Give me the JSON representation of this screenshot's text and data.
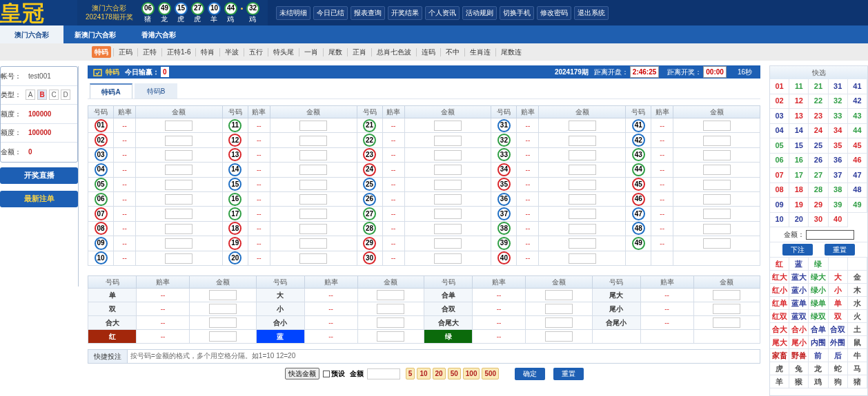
{
  "header": {
    "logo": "皇冠",
    "lottery_name": "澳门六合彩",
    "draw": "2024178期开奖",
    "balls": [
      {
        "number": "06",
        "zodiac": "猪",
        "color": "#2f9e44"
      },
      {
        "number": "49",
        "zodiac": "龙",
        "color": "#2f9e44"
      },
      {
        "number": "15",
        "zodiac": "虎",
        "color": "#1f6fc4"
      },
      {
        "number": "27",
        "zodiac": "虎",
        "color": "#2f9e44"
      },
      {
        "number": "10",
        "zodiac": "羊",
        "color": "#1f6fc4"
      },
      {
        "number": "44",
        "zodiac": "鸡",
        "color": "#2f9e44"
      }
    ],
    "special_ball": {
      "number": "32",
      "zodiac": "鸡",
      "color": "#2f9e44"
    }
  },
  "nav": [
    "未结明细",
    "今日已结",
    "报表查询",
    "开奖结果",
    "个人资讯",
    "活动规则",
    "切换手机",
    "修改密码",
    "退出系统"
  ],
  "tabs": [
    {
      "label": "澳门六合彩",
      "selected": true
    },
    {
      "label": "新澳门六合彩",
      "selected": false
    },
    {
      "label": "香港六合彩",
      "selected": false
    }
  ],
  "subnav": [
    {
      "label": "特码",
      "selected": true
    },
    {
      "label": "正码",
      "selected": false
    },
    {
      "label": "正特",
      "selected": false
    },
    {
      "label": "正特1-6",
      "selected": false
    },
    {
      "label": "特肖",
      "selected": false
    },
    {
      "label": "半波",
      "selected": false
    },
    {
      "label": "五行",
      "selected": false
    },
    {
      "label": "特头尾",
      "selected": false
    },
    {
      "label": "一肖",
      "selected": false
    },
    {
      "label": "尾数",
      "selected": false
    },
    {
      "label": "正肖",
      "selected": false
    },
    {
      "label": "总肖七色波",
      "selected": false
    },
    {
      "label": "连码",
      "selected": false
    },
    {
      "label": "不中",
      "selected": false
    },
    {
      "label": "生肖连",
      "selected": false
    },
    {
      "label": "尾数连",
      "selected": false
    }
  ],
  "account": {
    "rows": [
      {
        "kind": "text",
        "label": "帐号：",
        "value": "test001"
      },
      {
        "kind": "types",
        "label": "类型：",
        "options": [
          {
            "label": "A",
            "selected": false
          },
          {
            "label": "B",
            "selected": true
          },
          {
            "label": "C",
            "selected": false
          },
          {
            "label": "D",
            "selected": false
          }
        ]
      },
      {
        "kind": "money",
        "label": "额度：",
        "value": "100000"
      },
      {
        "kind": "money",
        "label": "额度：",
        "value": "100000"
      },
      {
        "kind": "money",
        "label": "金额：",
        "value": "0"
      }
    ],
    "buttons": [
      "开奖直播",
      "最新注单"
    ]
  },
  "panel": {
    "title": "特码",
    "today_label": "今日输赢：",
    "today_value": "0",
    "period": "2024179期",
    "open_label": "距离开盘：",
    "open_time": "2:46:25",
    "draw_label": "距离开奖：",
    "draw_time": "00:00",
    "countdown": "16秒"
  },
  "subtabs": [
    {
      "label": "特码A",
      "selected": true
    },
    {
      "label": "特码B",
      "selected": false
    }
  ],
  "table": {
    "groups": [
      {
        "columns": [
          "号码",
          "赔率",
          "金额"
        ],
        "items": [
          {
            "number": "01",
            "color": "#d9262b",
            "odds": "--"
          },
          {
            "number": "02",
            "color": "#d9262b",
            "odds": "--"
          },
          {
            "number": "03",
            "color": "#1f6fc4",
            "odds": "--"
          },
          {
            "number": "04",
            "color": "#1f6fc4",
            "odds": "--"
          },
          {
            "number": "05",
            "color": "#2f9e44",
            "odds": "--"
          },
          {
            "number": "06",
            "color": "#2f9e44",
            "odds": "--"
          },
          {
            "number": "07",
            "color": "#d9262b",
            "odds": "--"
          },
          {
            "number": "08",
            "color": "#d9262b",
            "odds": "--"
          },
          {
            "number": "09",
            "color": "#1f6fc4",
            "odds": "--"
          },
          {
            "number": "10",
            "color": "#1f6fc4",
            "odds": "--"
          }
        ]
      },
      {
        "columns": [
          "号码",
          "赔率",
          "金额"
        ],
        "items": [
          {
            "number": "11",
            "color": "#2f9e44",
            "odds": "--"
          },
          {
            "number": "12",
            "color": "#d9262b",
            "odds": "--"
          },
          {
            "number": "13",
            "color": "#d9262b",
            "odds": "--"
          },
          {
            "number": "14",
            "color": "#1f6fc4",
            "odds": "--"
          },
          {
            "number": "15",
            "color": "#1f6fc4",
            "odds": "--"
          },
          {
            "number": "16",
            "color": "#2f9e44",
            "odds": "--"
          },
          {
            "number": "17",
            "color": "#2f9e44",
            "odds": "--"
          },
          {
            "number": "18",
            "color": "#d9262b",
            "odds": "--"
          },
          {
            "number": "19",
            "color": "#d9262b",
            "odds": "--"
          },
          {
            "number": "20",
            "color": "#1f6fc4",
            "odds": "--"
          }
        ]
      },
      {
        "columns": [
          "号码",
          "赔率",
          "金额"
        ],
        "items": [
          {
            "number": "21",
            "color": "#2f9e44",
            "odds": "--"
          },
          {
            "number": "22",
            "color": "#2f9e44",
            "odds": "--"
          },
          {
            "number": "23",
            "color": "#d9262b",
            "odds": "--"
          },
          {
            "number": "24",
            "color": "#d9262b",
            "odds": "--"
          },
          {
            "number": "25",
            "color": "#1f6fc4",
            "odds": "--"
          },
          {
            "number": "26",
            "color": "#1f6fc4",
            "odds": "--"
          },
          {
            "number": "27",
            "color": "#2f9e44",
            "odds": "--"
          },
          {
            "number": "28",
            "color": "#2f9e44",
            "odds": "--"
          },
          {
            "number": "29",
            "color": "#d9262b",
            "odds": "--"
          },
          {
            "number": "30",
            "color": "#d9262b",
            "odds": "--"
          }
        ]
      },
      {
        "columns": [
          "号码",
          "赔率",
          "金额"
        ],
        "items": [
          {
            "number": "31",
            "color": "#1f6fc4",
            "odds": "--"
          },
          {
            "number": "32",
            "color": "#2f9e44",
            "odds": "--"
          },
          {
            "number": "33",
            "color": "#2f9e44",
            "odds": "--"
          },
          {
            "number": "34",
            "color": "#d9262b",
            "odds": "--"
          },
          {
            "number": "35",
            "color": "#d9262b",
            "odds": "--"
          },
          {
            "number": "36",
            "color": "#1f6fc4",
            "odds": "--"
          },
          {
            "number": "37",
            "color": "#1f6fc4",
            "odds": "--"
          },
          {
            "number": "38",
            "color": "#2f9e44",
            "odds": "--"
          },
          {
            "number": "39",
            "color": "#2f9e44",
            "odds": "--"
          },
          {
            "number": "40",
            "color": "#d9262b",
            "odds": "--"
          }
        ]
      },
      {
        "columns": [
          "号码",
          "赔率",
          "金额"
        ],
        "items": [
          {
            "number": "41",
            "color": "#1f6fc4",
            "odds": "--"
          },
          {
            "number": "42",
            "color": "#1f6fc4",
            "odds": "--"
          },
          {
            "number": "43",
            "color": "#2f9e44",
            "odds": "--"
          },
          {
            "number": "44",
            "color": "#2f9e44",
            "odds": "--"
          },
          {
            "number": "45",
            "color": "#d9262b",
            "odds": "--"
          },
          {
            "number": "46",
            "color": "#d9262b",
            "odds": "--"
          },
          {
            "number": "47",
            "color": "#1f6fc4",
            "odds": "--"
          },
          {
            "number": "48",
            "color": "#1f6fc4",
            "odds": "--"
          },
          {
            "number": "49",
            "color": "#2f9e44",
            "odds": "--"
          }
        ]
      }
    ]
  },
  "side_table": {
    "groups": [
      {
        "columns": [
          "号码",
          "赔率",
          "金额"
        ],
        "items": [
          {
            "kind": "text",
            "label": "单",
            "odds": "--"
          },
          {
            "kind": "text",
            "label": "双",
            "odds": "--"
          },
          {
            "kind": "text",
            "label": "合大",
            "odds": "--"
          },
          {
            "kind": "color",
            "label": "红",
            "color": "#a3270b",
            "odds": "--"
          }
        ]
      },
      {
        "columns": [
          "号码",
          "赔率",
          "金额"
        ],
        "items": [
          {
            "kind": "text",
            "label": "大",
            "odds": "--"
          },
          {
            "kind": "text",
            "label": "小",
            "odds": "--"
          },
          {
            "kind": "text",
            "label": "合小",
            "odds": "--"
          },
          {
            "kind": "color",
            "label": "蓝",
            "color": "#0044ff",
            "odds": "--"
          }
        ]
      },
      {
        "columns": [
          "号码",
          "赔率",
          "金额"
        ],
        "items": [
          {
            "kind": "text",
            "label": "合单",
            "odds": "--"
          },
          {
            "kind": "text",
            "label": "合双",
            "odds": "--"
          },
          {
            "kind": "text",
            "label": "合尾大",
            "odds": "--"
          },
          {
            "kind": "color",
            "label": "绿",
            "color": "#0b6a0b",
            "odds": "--"
          }
        ]
      },
      {
        "columns": [
          "号码",
          "赔率",
          "金额"
        ],
        "items": [
          {
            "kind": "text",
            "label": "尾大",
            "odds": "--"
          },
          {
            "kind": "text",
            "label": "尾小",
            "odds": "--"
          },
          {
            "kind": "text",
            "label": "合尾小",
            "odds": "--"
          }
        ]
      }
    ]
  },
  "quick_bet": {
    "label": "快捷投注",
    "placeholder": "按号码=金额的格式，多个用空格分隔。如1=10 12=20"
  },
  "controls": {
    "quick_amount": "快选金额",
    "preset": {
      "label": "预设",
      "checked": false
    },
    "amount_label": "金额",
    "chips": [
      "5",
      "10",
      "20",
      "50",
      "100",
      "500"
    ],
    "confirm": "确定",
    "reset": "重置"
  },
  "quick_pick": {
    "title": "快选",
    "numbers": [
      {
        "number": "01",
        "color": "#d9262b"
      },
      {
        "number": "11",
        "color": "#2f9e44"
      },
      {
        "number": "21",
        "color": "#2f9e44"
      },
      {
        "number": "31",
        "color": "#2b3a9a"
      },
      {
        "number": "41",
        "color": "#2b3a9a"
      },
      {
        "number": "02",
        "color": "#d9262b"
      },
      {
        "number": "12",
        "color": "#d9262b"
      },
      {
        "number": "22",
        "color": "#2f9e44"
      },
      {
        "number": "32",
        "color": "#2f9e44"
      },
      {
        "number": "42",
        "color": "#2b3a9a"
      },
      {
        "number": "03",
        "color": "#2b3a9a"
      },
      {
        "number": "13",
        "color": "#d9262b"
      },
      {
        "number": "23",
        "color": "#d9262b"
      },
      {
        "number": "33",
        "color": "#2f9e44"
      },
      {
        "number": "43",
        "color": "#2f9e44"
      },
      {
        "number": "04",
        "color": "#2b3a9a"
      },
      {
        "number": "14",
        "color": "#2b3a9a"
      },
      {
        "number": "24",
        "color": "#d9262b"
      },
      {
        "number": "34",
        "color": "#d9262b"
      },
      {
        "number": "44",
        "color": "#2f9e44"
      },
      {
        "number": "05",
        "color": "#2f9e44"
      },
      {
        "number": "15",
        "color": "#2b3a9a"
      },
      {
        "number": "25",
        "color": "#2b3a9a"
      },
      {
        "number": "35",
        "color": "#d9262b"
      },
      {
        "number": "45",
        "color": "#d9262b"
      },
      {
        "number": "06",
        "color": "#2f9e44"
      },
      {
        "number": "16",
        "color": "#2f9e44"
      },
      {
        "number": "26",
        "color": "#2b3a9a"
      },
      {
        "number": "36",
        "color": "#2b3a9a"
      },
      {
        "number": "46",
        "color": "#d9262b"
      },
      {
        "number": "07",
        "color": "#d9262b"
      },
      {
        "number": "17",
        "color": "#2f9e44"
      },
      {
        "number": "27",
        "color": "#2f9e44"
      },
      {
        "number": "37",
        "color": "#2b3a9a"
      },
      {
        "number": "47",
        "color": "#2b3a9a"
      },
      {
        "number": "08",
        "color": "#d9262b"
      },
      {
        "number": "18",
        "color": "#d9262b"
      },
      {
        "number": "28",
        "color": "#2f9e44"
      },
      {
        "number": "38",
        "color": "#2f9e44"
      },
      {
        "number": "48",
        "color": "#2b3a9a"
      },
      {
        "number": "09",
        "color": "#2b3a9a"
      },
      {
        "number": "19",
        "color": "#d9262b"
      },
      {
        "number": "29",
        "color": "#d9262b"
      },
      {
        "number": "39",
        "color": "#2f9e44"
      },
      {
        "number": "49",
        "color": "#2f9e44"
      },
      {
        "number": "10",
        "color": "#2b3a9a"
      },
      {
        "number": "20",
        "color": "#2b3a9a"
      },
      {
        "number": "30",
        "color": "#d9262b"
      },
      {
        "number": "40",
        "color": "#d9262b"
      }
    ],
    "amount_label": "金额：",
    "buttons": [
      "下注",
      "重置"
    ],
    "options": [
      [
        {
          "label": "红",
          "color": "#d9262b"
        },
        {
          "label": "蓝",
          "color": "#2b3a9a"
        },
        {
          "label": "绿",
          "color": "#2f9e44"
        }
      ],
      [
        {
          "label": "红大",
          "color": "#d9262b"
        },
        {
          "label": "蓝大",
          "color": "#2b3a9a"
        },
        {
          "label": "绿大",
          "color": "#2f9e44"
        },
        {
          "label": "大",
          "color": "#d9262b"
        },
        {
          "label": "金",
          "color": "#555555"
        }
      ],
      [
        {
          "label": "红小",
          "color": "#d9262b"
        },
        {
          "label": "蓝小",
          "color": "#2b3a9a"
        },
        {
          "label": "绿小",
          "color": "#2f9e44"
        },
        {
          "label": "小",
          "color": "#d9262b"
        },
        {
          "label": "木",
          "color": "#555555"
        }
      ],
      [
        {
          "label": "红单",
          "color": "#d9262b"
        },
        {
          "label": "蓝单",
          "color": "#2b3a9a"
        },
        {
          "label": "绿单",
          "color": "#2f9e44"
        },
        {
          "label": "单",
          "color": "#d9262b"
        },
        {
          "label": "水",
          "color": "#555555"
        }
      ],
      [
        {
          "label": "红双",
          "color": "#d9262b"
        },
        {
          "label": "蓝双",
          "color": "#2b3a9a"
        },
        {
          "label": "绿双",
          "color": "#2f9e44"
        },
        {
          "label": "双",
          "color": "#d9262b"
        },
        {
          "label": "火",
          "color": "#555555"
        }
      ],
      [
        {
          "label": "合大",
          "color": "#d9262b"
        },
        {
          "label": "合小",
          "color": "#d9262b"
        },
        {
          "label": "合单",
          "color": "#2b3a9a"
        },
        {
          "label": "合双",
          "color": "#2b3a9a"
        },
        {
          "label": "土",
          "color": "#555555"
        }
      ],
      [
        {
          "label": "尾大",
          "color": "#d9262b"
        },
        {
          "label": "尾小",
          "color": "#d9262b"
        },
        {
          "label": "内围",
          "color": "#2b3a9a"
        },
        {
          "label": "外围",
          "color": "#2b3a9a"
        },
        {
          "label": "鼠",
          "color": "#555555"
        }
      ],
      [
        {
          "label": "家畜",
          "color": "#c01818"
        },
        {
          "label": "野兽",
          "color": "#c01818"
        },
        {
          "label": "前",
          "color": "#2b3a9a"
        },
        {
          "label": "后",
          "color": "#2b3a9a"
        },
        {
          "label": "牛",
          "color": "#555555"
        }
      ],
      [
        {
          "label": "虎",
          "color": "#555555"
        },
        {
          "label": "兔",
          "color": "#555555"
        },
        {
          "label": "龙",
          "color": "#555555"
        },
        {
          "label": "蛇",
          "color": "#555555"
        },
        {
          "label": "马",
          "color": "#555555"
        }
      ],
      [
        {
          "label": "羊",
          "color": "#555555"
        },
        {
          "label": "猴",
          "color": "#555555"
        },
        {
          "label": "鸡",
          "color": "#555555"
        },
        {
          "label": "狗",
          "color": "#555555"
        },
        {
          "label": "猪",
          "color": "#555555"
        }
      ]
    ]
  }
}
